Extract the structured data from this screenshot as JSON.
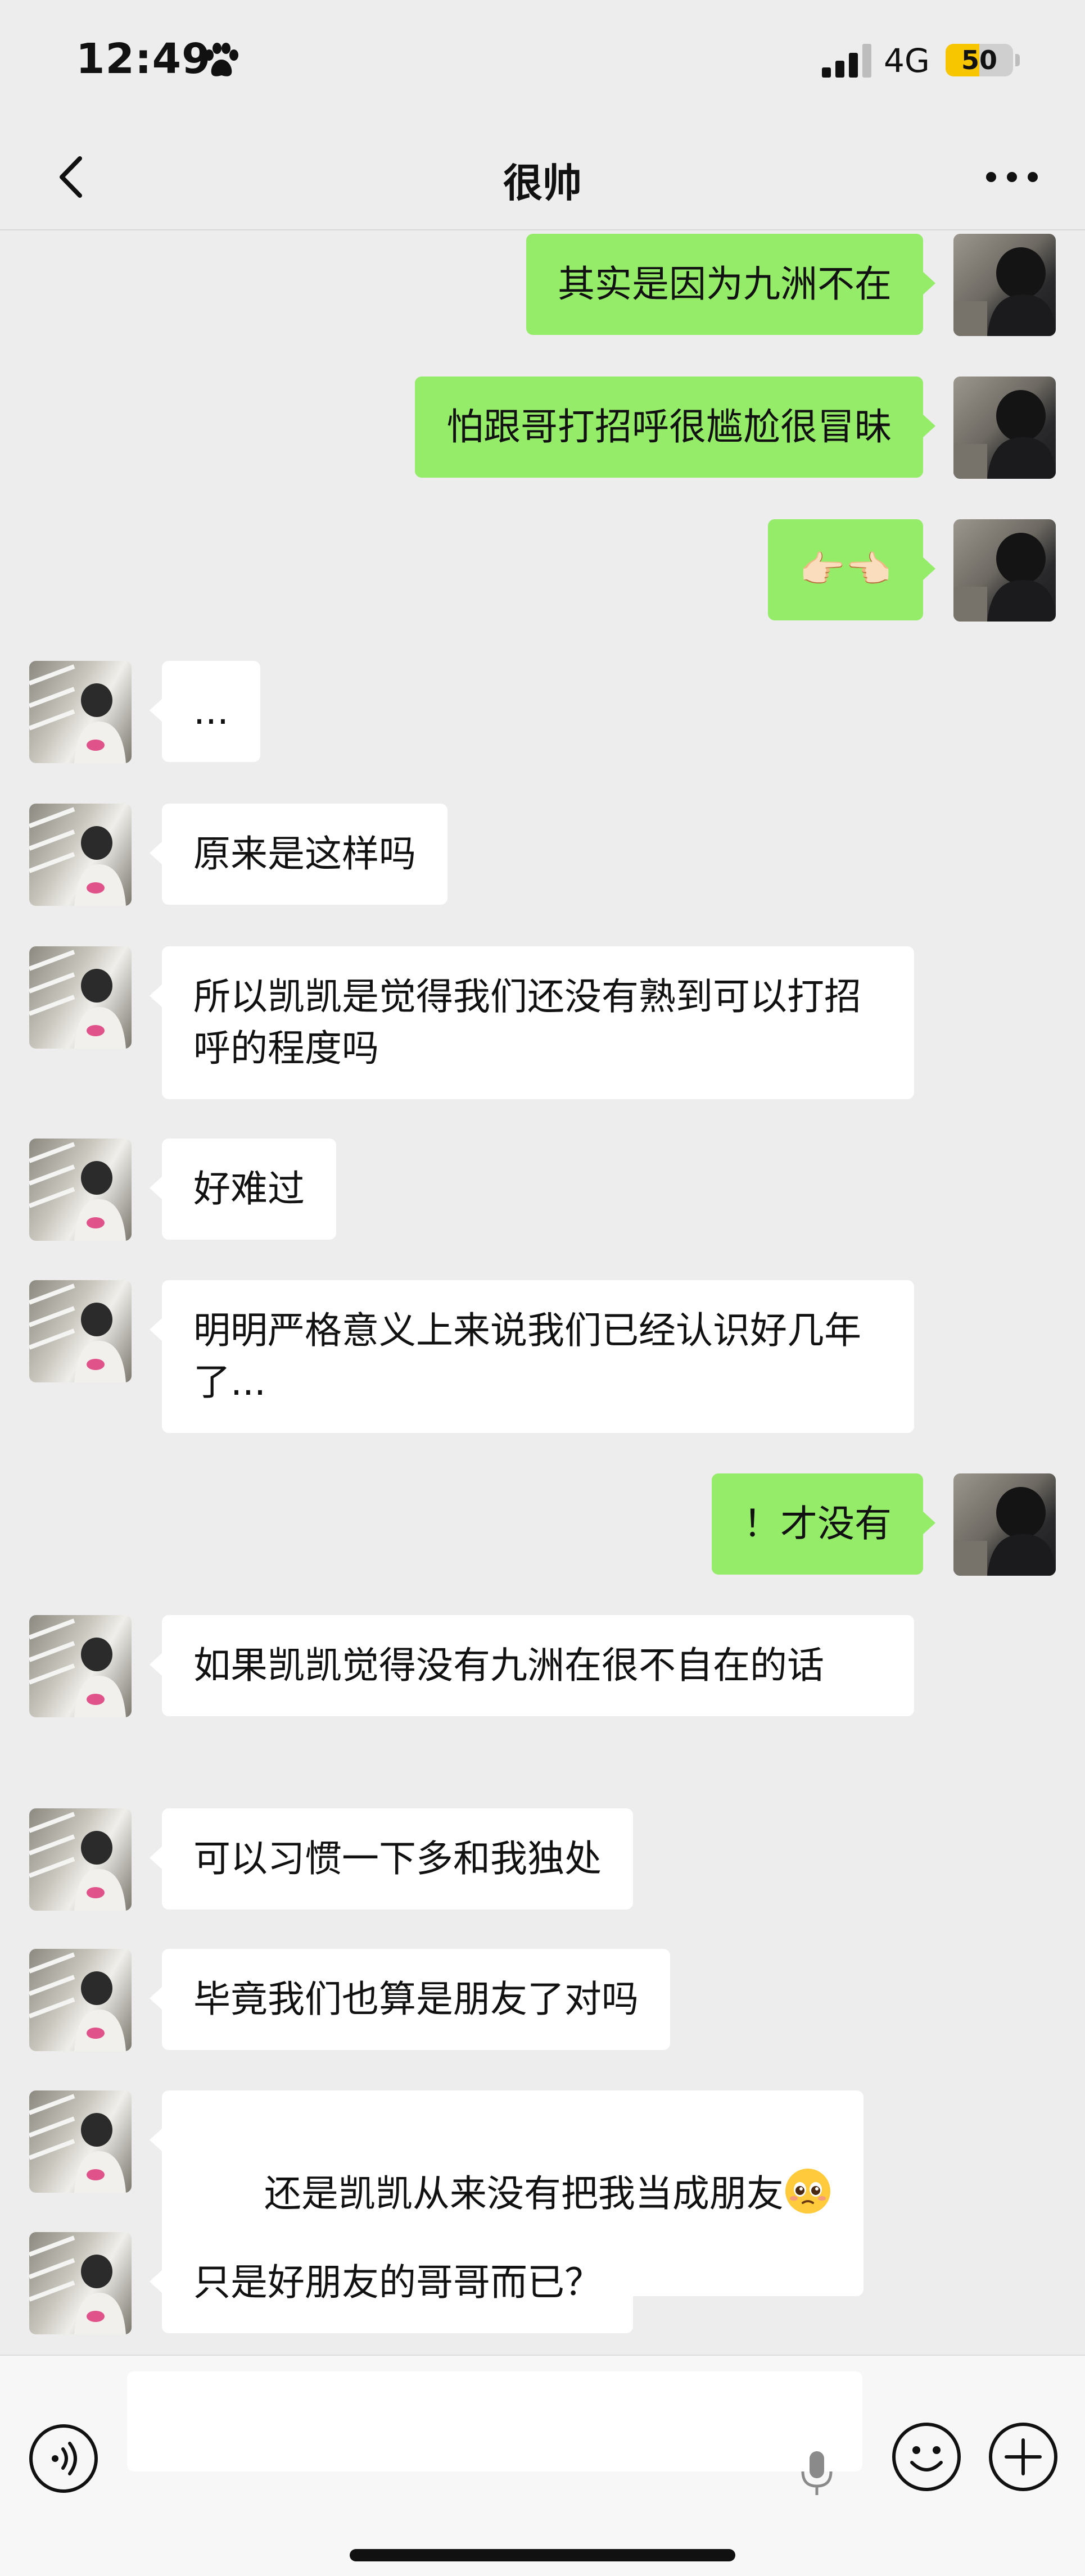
{
  "status_bar": {
    "time": "12:49",
    "network": "4G",
    "battery": "50",
    "battery_level": 0.5,
    "icons": [
      "paw-icon",
      "signal-icon"
    ]
  },
  "header": {
    "title": "很帅",
    "back_icon": "chevron-left-icon",
    "more_icon": "more-dots-icon"
  },
  "messages": [
    {
      "sender": "me",
      "text": "其实是因为九洲不在"
    },
    {
      "sender": "me",
      "text": "怕跟哥打招呼很尴尬很冒昧"
    },
    {
      "sender": "me",
      "text": "👉🏻👈🏻"
    },
    {
      "sender": "other",
      "text": "..."
    },
    {
      "sender": "other",
      "text": "原来是这样吗"
    },
    {
      "sender": "other",
      "text": "所以凯凯是觉得我们还没有熟到可以打招呼的程度吗"
    },
    {
      "sender": "other",
      "text": "好难过"
    },
    {
      "sender": "other",
      "text": "明明严格意义上来说我们已经认识好几年了..."
    },
    {
      "sender": "me",
      "text": "！才没有"
    },
    {
      "sender": "other",
      "text": "如果凯凯觉得没有九洲在很不自在的话"
    },
    {
      "sender": "other",
      "text": "可以习惯一下多和我独处"
    },
    {
      "sender": "other",
      "text": "毕竟我们也算是朋友了对吗"
    },
    {
      "sender": "other",
      "text": "还是凯凯从来没有把我当成朋友"
    },
    {
      "sender": "other",
      "text": "只是好朋友的哥哥而已？"
    }
  ],
  "input_bar": {
    "placeholder": "",
    "icons": [
      "voice-icon",
      "microphone-icon",
      "emoji-icon",
      "plus-icon"
    ]
  }
}
